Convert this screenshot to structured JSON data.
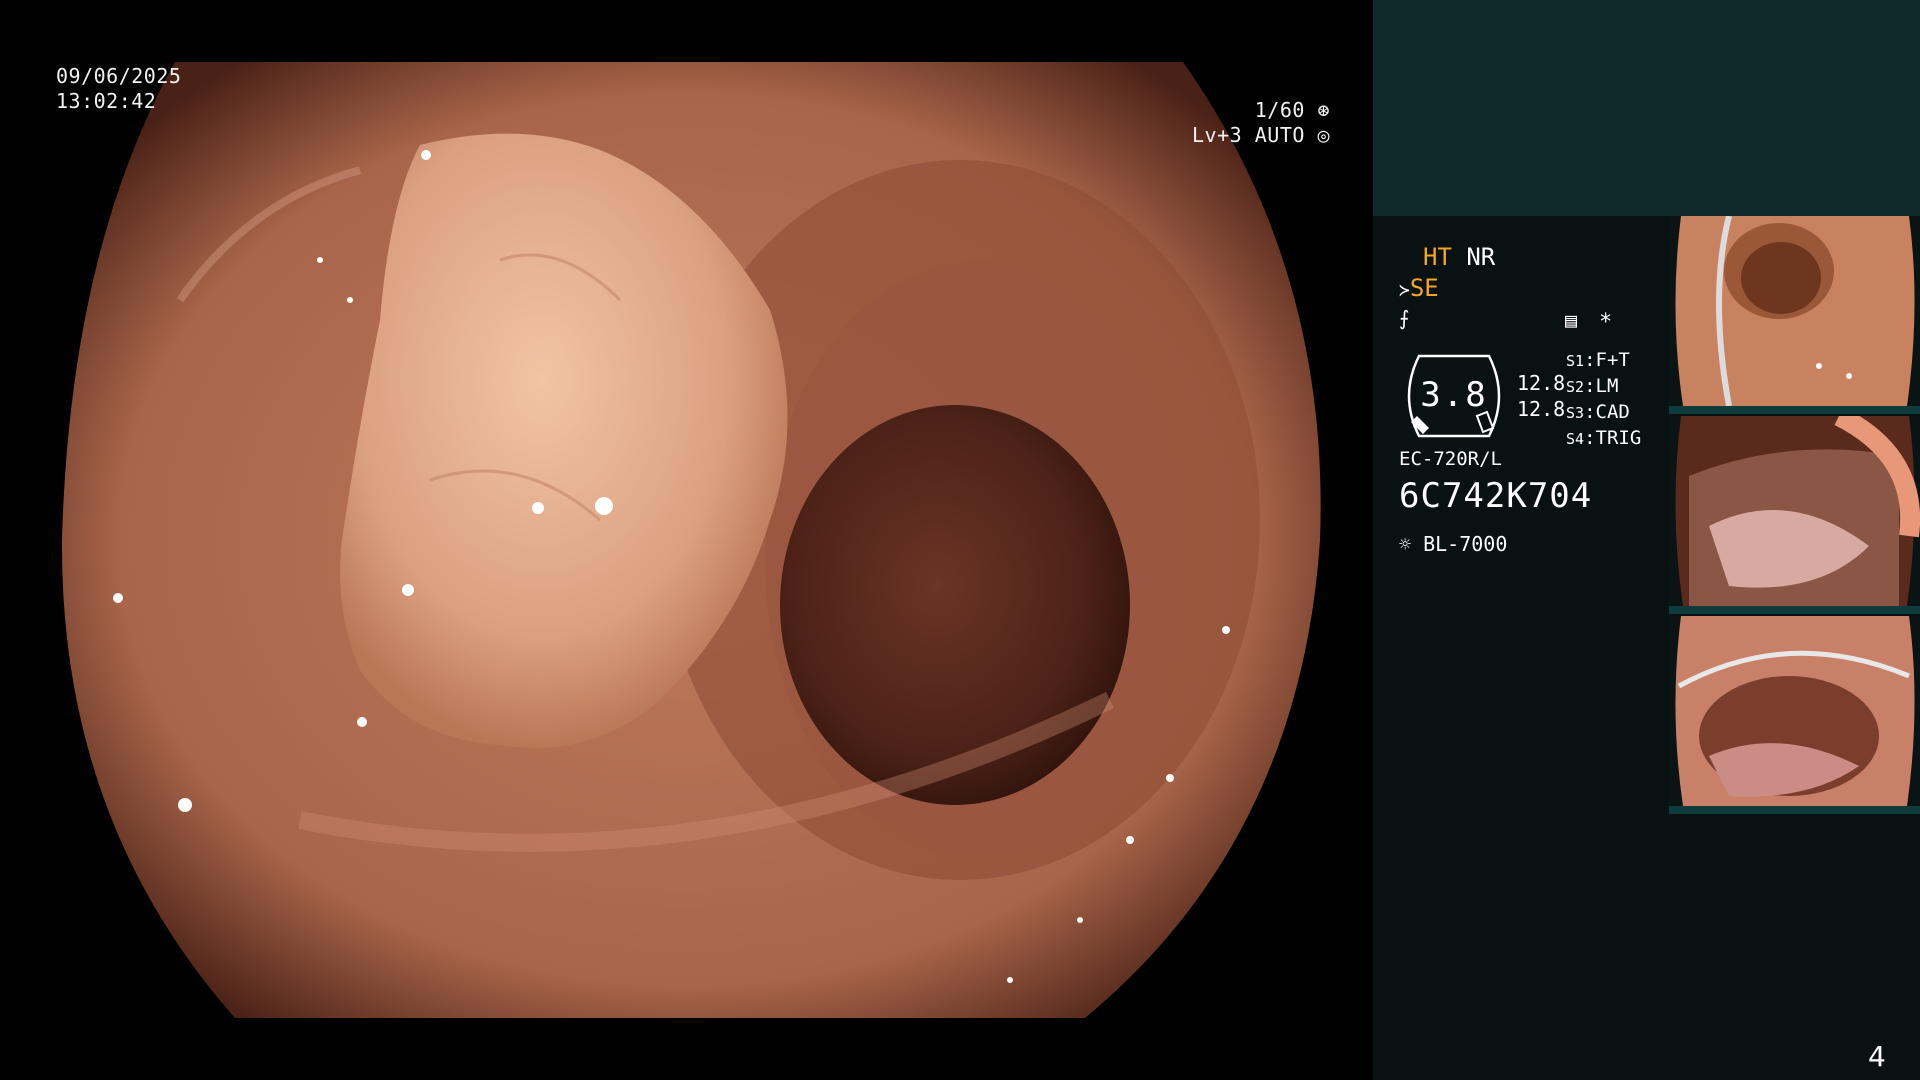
{
  "endoscope_view": {
    "date": "09/06/2025",
    "time": "13:02:42",
    "shutter": "1/60",
    "level": "Lv+3",
    "mode": "AUTO",
    "shutter_icon": "aperture-icon",
    "mode_icon": "auto-iris-icon"
  },
  "side_panel": {
    "ht": "HT",
    "nr": "NR",
    "se": "SE",
    "se_icon": "hose-icon",
    "aux_icon": "signal-icon",
    "menu_icon": "settings-list-icon",
    "asterisk": "*",
    "iris_value": "3.8",
    "num1": "12.8",
    "num2": "12.8",
    "switches": [
      {
        "key": "S1",
        "value": "F+T"
      },
      {
        "key": "S2",
        "value": "LM"
      },
      {
        "key": "S3",
        "value": "CAD"
      },
      {
        "key": "S4",
        "value": "TRIG"
      }
    ],
    "scope_model": "EC-720R/L",
    "serial": "6C742K704",
    "light_icon": "lamp-icon",
    "light_source": "BL-7000"
  },
  "page_number": "4",
  "colors": {
    "side_bg": "#0a1112",
    "side_top": "#0f2a2b",
    "accent_orange": "#f5a623",
    "mucosa": "#b56f52"
  }
}
